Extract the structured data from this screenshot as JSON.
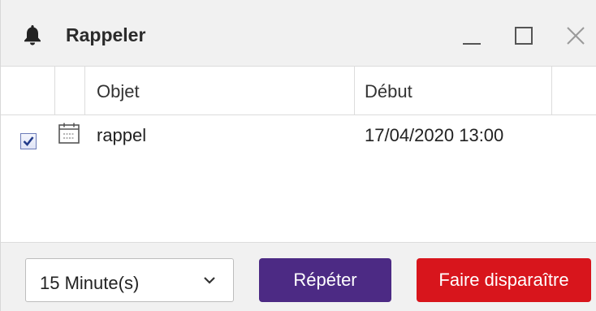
{
  "window": {
    "title": "Rappeler",
    "icon": "bell-icon",
    "controls": [
      "minimize-icon",
      "maximize-icon",
      "close-icon"
    ]
  },
  "grid": {
    "columns": [
      "",
      "",
      "Objet",
      "Début"
    ],
    "rows": [
      {
        "checked": true,
        "icon": "calendar-icon",
        "subject": "rappel",
        "start": "17/04/2020 13:00"
      }
    ]
  },
  "footer": {
    "snooze_select": {
      "value": "15 Minute(s)"
    },
    "snooze_button": "Répéter",
    "dismiss_button": "Faire disparaître"
  },
  "colors": {
    "snooze": "#4c2a84",
    "dismiss": "#d8151c",
    "titlebar": "#f1f1f1"
  }
}
